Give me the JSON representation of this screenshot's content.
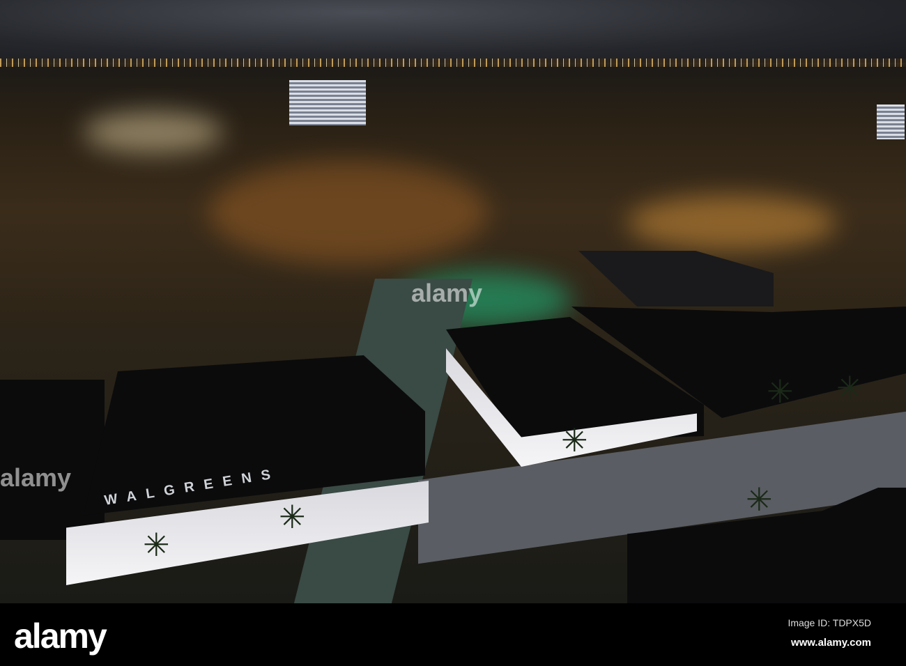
{
  "photo": {
    "description_label": "Aerial night view of city with Walgreens store",
    "store_sign": "WALGREENS",
    "watermark": "alamy"
  },
  "footer": {
    "logo": "alamy",
    "image_id": "Image ID: TDPX5D",
    "url": "www.alamy.com"
  }
}
